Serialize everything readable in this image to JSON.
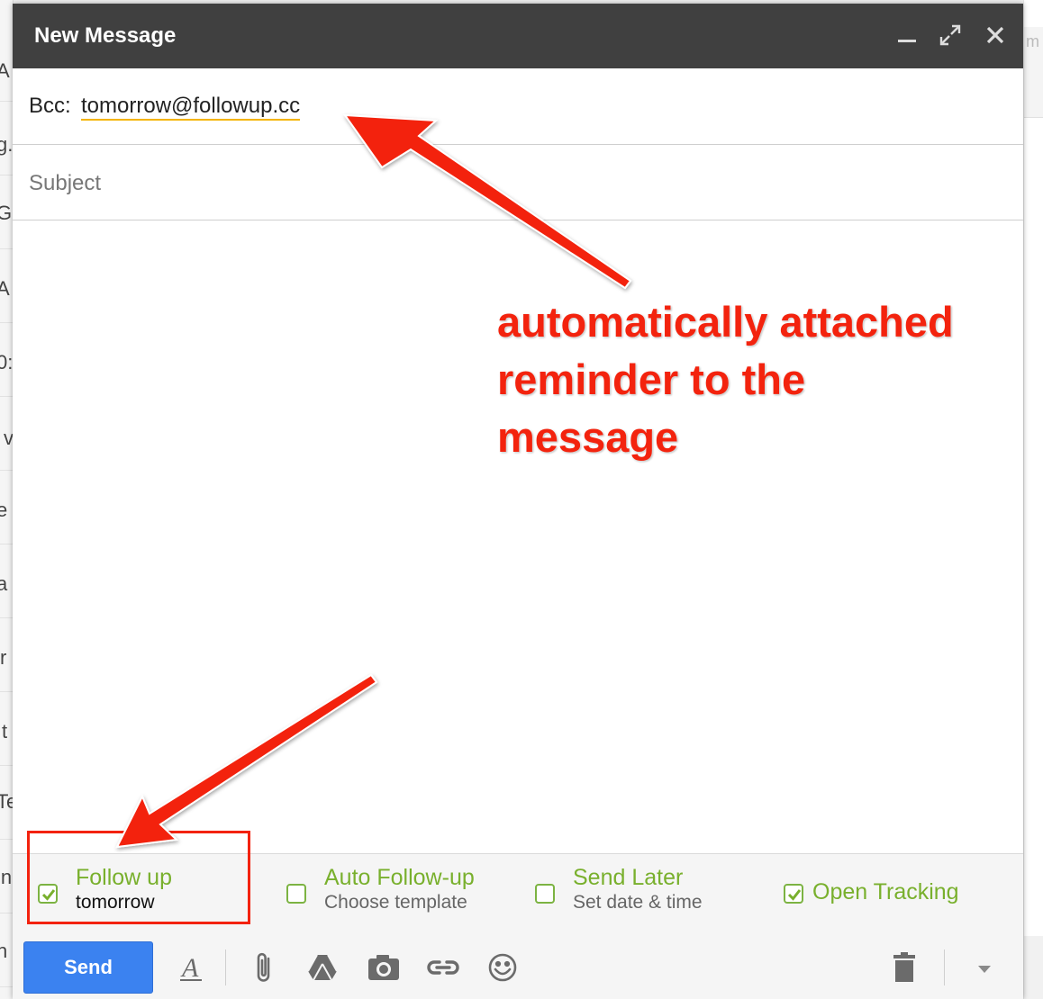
{
  "background": {
    "left_glyphs": [
      "A",
      "g.",
      "G",
      "A",
      "0:",
      "v",
      "e",
      "a",
      "r",
      "t",
      "Te",
      "in",
      "n"
    ],
    "right_glyph": "m"
  },
  "compose": {
    "title": "New Message",
    "bcc_label": "Bcc:",
    "bcc_address": "tomorrow@followup.cc",
    "subject_placeholder": "Subject"
  },
  "options": {
    "follow_up": {
      "title": "Follow up",
      "subtitle": "tomorrow",
      "checked": true
    },
    "auto_follow_up": {
      "title": "Auto Follow-up",
      "subtitle": "Choose template",
      "checked": false
    },
    "send_later": {
      "title": "Send Later",
      "subtitle": "Set date & time",
      "checked": false
    },
    "open_tracking": {
      "title": "Open Tracking",
      "checked": true
    }
  },
  "toolbar": {
    "send_label": "Send",
    "format_glyph": "A"
  },
  "annotation": {
    "lines": [
      "automatically attached",
      "reminder to the",
      "message"
    ]
  },
  "colors": {
    "titlebar": "#404040",
    "accent_green": "#79b02d",
    "send_blue": "#3b82f0",
    "annotation_red": "#f3230e"
  }
}
